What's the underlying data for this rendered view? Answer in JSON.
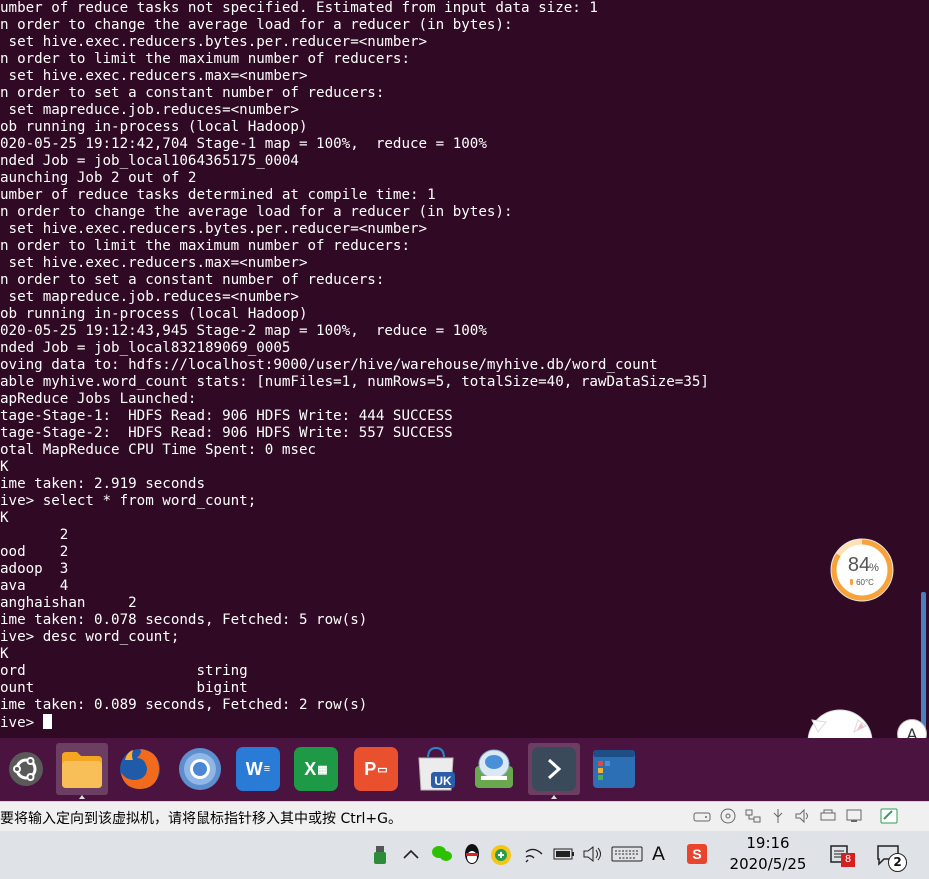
{
  "terminal": {
    "lines": [
      "umber of reduce tasks not specified. Estimated from input data size: 1",
      "n order to change the average load for a reducer (in bytes):",
      " set hive.exec.reducers.bytes.per.reducer=<number>",
      "n order to limit the maximum number of reducers:",
      " set hive.exec.reducers.max=<number>",
      "n order to set a constant number of reducers:",
      " set mapreduce.job.reduces=<number>",
      "ob running in-process (local Hadoop)",
      "020-05-25 19:12:42,704 Stage-1 map = 100%,  reduce = 100%",
      "nded Job = job_local1064365175_0004",
      "aunching Job 2 out of 2",
      "umber of reduce tasks determined at compile time: 1",
      "n order to change the average load for a reducer (in bytes):",
      " set hive.exec.reducers.bytes.per.reducer=<number>",
      "n order to limit the maximum number of reducers:",
      " set hive.exec.reducers.max=<number>",
      "n order to set a constant number of reducers:",
      " set mapreduce.job.reduces=<number>",
      "ob running in-process (local Hadoop)",
      "020-05-25 19:12:43,945 Stage-2 map = 100%,  reduce = 100%",
      "nded Job = job_local832189069_0005",
      "oving data to: hdfs://localhost:9000/user/hive/warehouse/myhive.db/word_count",
      "able myhive.word_count stats: [numFiles=1, numRows=5, totalSize=40, rawDataSize=35]",
      "apReduce Jobs Launched:",
      "tage-Stage-1:  HDFS Read: 906 HDFS Write: 444 SUCCESS",
      "tage-Stage-2:  HDFS Read: 906 HDFS Write: 557 SUCCESS",
      "otal MapReduce CPU Time Spent: 0 msec",
      "K",
      "ime taken: 2.919 seconds",
      "ive> select * from word_count;",
      "K",
      "       2",
      "ood    2",
      "adoop  3",
      "ava    4",
      "anghaishan     2",
      "ime taken: 0.078 seconds, Fetched: 5 row(s)",
      "ive> desc word_count;",
      "K",
      "ord                    string",
      "ount                   bigint",
      "ime taken: 0.089 seconds, Fetched: 2 row(s)"
    ],
    "prompt": "ive> "
  },
  "dock": {
    "items": [
      {
        "name": "ubuntu-software",
        "icon": "ubuntu-icon",
        "color": "#3c3c3c"
      },
      {
        "name": "files",
        "icon": "folder-icon",
        "color": "#f2a73b",
        "active": true
      },
      {
        "name": "firefox",
        "icon": "firefox-icon",
        "color": "#e66000"
      },
      {
        "name": "chromium",
        "icon": "chromium-icon",
        "color": "#6e9ed8"
      },
      {
        "name": "writer",
        "icon": "writer-icon",
        "color": "#2a7bd6",
        "letter": "W"
      },
      {
        "name": "calc",
        "icon": "calc-icon",
        "color": "#1e9a47",
        "letter": "X"
      },
      {
        "name": "impress",
        "icon": "impress-icon",
        "color": "#e9502e",
        "letter": "P"
      },
      {
        "name": "ubuntu-one",
        "icon": "shopping-bag-icon",
        "color": "#e6e6e6",
        "letter": "UK"
      },
      {
        "name": "driver",
        "icon": "driver-icon",
        "color": "#5aa0d8"
      },
      {
        "name": "terminal",
        "icon": "terminal-icon",
        "color": "#3a4a5a",
        "active": true
      },
      {
        "name": "show-apps",
        "icon": "apps-window-icon",
        "color": "#2c6fb5"
      }
    ]
  },
  "vm_status": {
    "hint": "要将输入定向到该虚拟机，请将鼠标指针移入其中或按 Ctrl+G。"
  },
  "overlay": {
    "perf_percent": "84",
    "perf_unit": "%",
    "temperature": "60°C",
    "perf_value": 0.84
  },
  "side_buttons": {
    "a_label": "A"
  },
  "taskbar": {
    "ime_label": "A",
    "time": "19:16",
    "date": "2020/5/25",
    "notification_badge": "8",
    "chat_badge": "2"
  },
  "colors": {
    "terminal_bg": "#300a24",
    "dock_bg": "#4b1440",
    "gauge_ring": "#f7a23b"
  }
}
